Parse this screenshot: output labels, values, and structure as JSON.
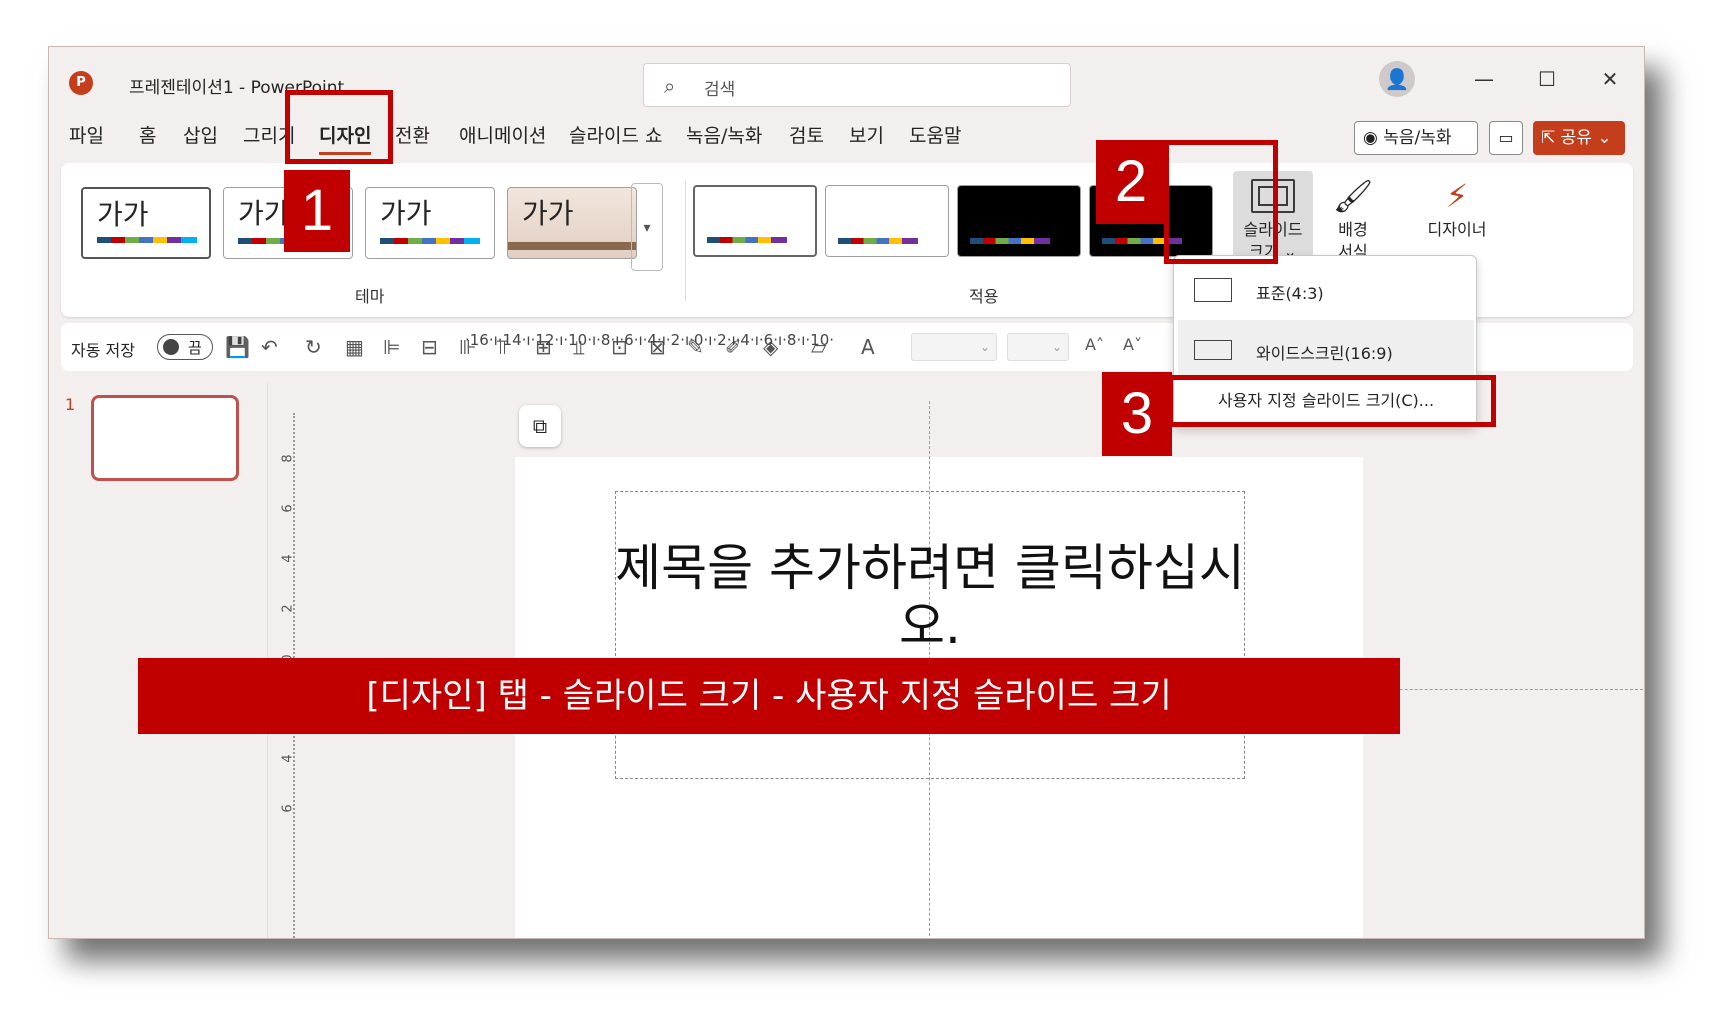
{
  "window": {
    "app_logo": "P",
    "doc_title": "프레젠테이션1  -  PowerPoint",
    "search_placeholder": "검색"
  },
  "icons": {
    "search": "search-icon",
    "account": "person-icon",
    "minimize": "minimize-icon",
    "maximize": "maximize-icon",
    "close": "close-icon"
  },
  "tabs": [
    "파일",
    "홈",
    "삽입",
    "그리기",
    "디자인",
    "전환",
    "애니메이션",
    "슬라이드 쇼",
    "녹음/녹화",
    "검토",
    "보기",
    "도움말"
  ],
  "active_tab": "디자인",
  "header_buttons": {
    "record": "◉ 녹음/녹화",
    "comment": "▭",
    "share": "⇱ 공유 ⌄"
  },
  "ribbon": {
    "themes_label": "테마",
    "variants_label": "적용",
    "theme_thumb_text": "가가",
    "slide_size_label": "슬라이드\n크기 ⌄",
    "slide_size_line1": "슬라이드",
    "slide_size_line2": "크기 ⌄",
    "bg_format_line1": "배경",
    "bg_format_line2": "서식",
    "designer_label": "디자이너"
  },
  "quick_access": {
    "autosave_label": "자동 저장",
    "toggle_state": "끔"
  },
  "slides_panel": {
    "slide_number": "1"
  },
  "ruler": {
    "horizontal": "·16·ı·14·ı·12·ı·10·ı·8·ı·6·ı·4·ı·2·ı·0·ı·2·ı·4·ı·6·ı·8·ı·10·"
  },
  "slide": {
    "title_placeholder": "제목을 추가하려면 클릭하십시오."
  },
  "dropdown": {
    "standard": "표준(4:3)",
    "widescreen": "와이드스크린(16:9)",
    "custom": "사용자 지정 슬라이드 크기(C)..."
  },
  "annotations": {
    "step1": "1",
    "step2": "2",
    "step3": "3",
    "banner": "[디자인] 탭  -  슬라이드 크기  -  사용자 지정 슬라이드 크기",
    "highlight_color": "#c00000"
  },
  "colors": {
    "accent": "#c43e1c",
    "annotation_red": "#c00000"
  }
}
